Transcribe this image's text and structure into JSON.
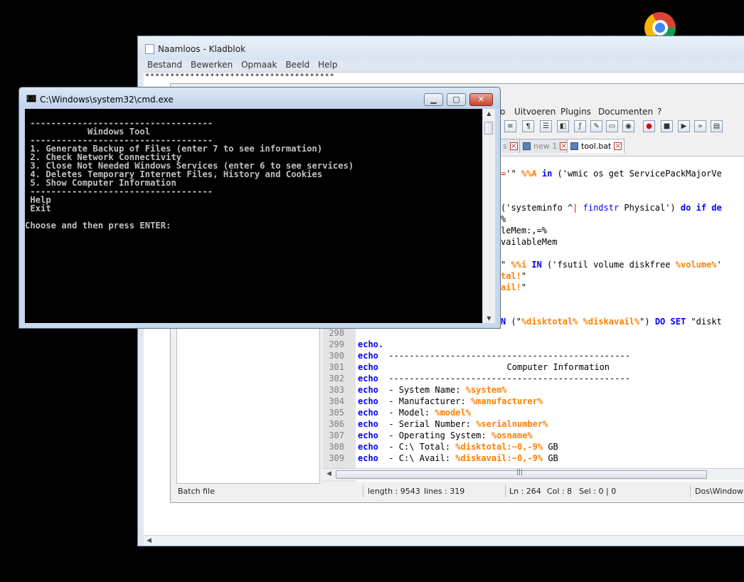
{
  "chrome_icon": "chrome-icon",
  "notepad": {
    "title": "Naamloos - Kladblok",
    "menu": [
      "Bestand",
      "Bewerken",
      "Opmaak",
      "Beeld",
      "Help"
    ],
    "text": "**************************************"
  },
  "npp": {
    "menu": [
      "o",
      "Uitvoeren",
      "Plugins",
      "Documenten",
      "?"
    ],
    "tabs": [
      {
        "label": "s"
      },
      {
        "label": "new 1"
      },
      {
        "label": "tool.bat"
      }
    ],
    "status": {
      "type": "Batch file",
      "length": "length : 9543",
      "lines": "lines : 319",
      "ln": "Ln : 264",
      "col": "Col : 8",
      "sel": "Sel : 0 | 0",
      "eol": "Dos\\Window"
    },
    "code_top": [
      {
        "t": "='\" %%A in ('wmic os get ServicePackMajorVe"
      },
      {
        "t": "('systeminfo ^| findstr Physical') do if de"
      },
      {
        "t": "%"
      },
      {
        "t": "leMem:,=%"
      },
      {
        "t": "vailableMem"
      },
      {
        "t": "\" %%i IN ('fsutil volume diskfree %volume%'"
      },
      {
        "t": "tal!\""
      },
      {
        "t": "ail!\""
      },
      {
        "t": "N (\"%disktotal% %diskavail%\") DO SET \"diskt"
      }
    ],
    "code_lines": [
      {
        "n": "298",
        "kw": "",
        "rest": ""
      },
      {
        "n": "299",
        "kw": "echo.",
        "rest": ""
      },
      {
        "n": "300",
        "kw": "echo",
        "rest": "  -----------------------------------------------"
      },
      {
        "n": "301",
        "kw": "echo",
        "rest": "                         Computer Information"
      },
      {
        "n": "302",
        "kw": "echo",
        "rest": "  -----------------------------------------------"
      },
      {
        "n": "303",
        "kw": "echo",
        "rest": "  - System Name: ",
        "v": "%system%",
        "tail": ""
      },
      {
        "n": "304",
        "kw": "echo",
        "rest": "  - Manufacturer: ",
        "v": "%manufacturer%",
        "tail": ""
      },
      {
        "n": "305",
        "kw": "echo",
        "rest": "  - Model: ",
        "v": "%model%",
        "tail": ""
      },
      {
        "n": "306",
        "kw": "echo",
        "rest": "  - Serial Number: ",
        "v": "%serialnumber%",
        "tail": ""
      },
      {
        "n": "307",
        "kw": "echo",
        "rest": "  - Operating System: ",
        "v": "%osname%",
        "tail": ""
      },
      {
        "n": "308",
        "kw": "echo",
        "rest": "  - C:\\ Total: ",
        "v": "%disktotal:~0,-9%",
        "tail": " GB"
      },
      {
        "n": "309",
        "kw": "echo",
        "rest": "  - C:\\ Avail: ",
        "v": "%diskavail:~0,-9%",
        "tail": " GB"
      }
    ]
  },
  "cmd": {
    "title": "C:\\Windows\\system32\\cmd.exe",
    "lines": [
      " -----------------------------------",
      "            Windows Tool",
      " -----------------------------------",
      " 1. Generate Backup of Files (enter 7 to see information)",
      " 2. Check Network Connectivity",
      " 3. Close Not Needed Windows Services (enter 6 to see services)",
      " 4. Deletes Temporary Internet Files, History and Cookies",
      " 5. Show Computer Information",
      " -----------------------------------",
      "",
      " Help",
      " Exit",
      "",
      "Choose and then press ENTER:"
    ]
  }
}
